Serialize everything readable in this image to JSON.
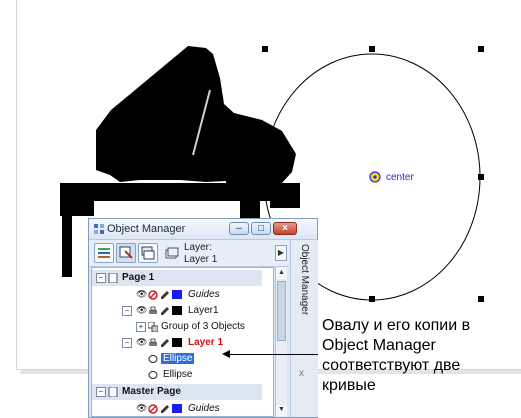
{
  "canvas": {
    "ellipse_label": "center"
  },
  "object_manager": {
    "title": "Object Manager",
    "side_tab_label": "Object Manager",
    "side_tab_close": "x",
    "toolbar": {
      "layer_caption": "Layer:",
      "layer_name": "Layer 1"
    },
    "tree": [
      {
        "label": "Page 1",
        "level": "page"
      },
      {
        "label": "Guides",
        "level": "layer"
      },
      {
        "label": "Layer1",
        "level": "layer"
      },
      {
        "label": "Group of 3 Objects",
        "level": "object"
      },
      {
        "label": "Layer 1",
        "level": "layer"
      },
      {
        "label": "Ellipse",
        "level": "object",
        "selected": true
      },
      {
        "label": "Ellipse",
        "level": "object"
      },
      {
        "label": "Master Page",
        "level": "page"
      },
      {
        "label": "Guides",
        "level": "layer"
      }
    ]
  },
  "annotation": {
    "lines": [
      "Овалу и его копии в",
      "Object Manager",
      "соответствуют две",
      "кривые"
    ]
  },
  "colors": {
    "selection": "#2f6fd2",
    "active_layer": "#d01010",
    "guides_swatch": "#1a1aff",
    "layer_swatch": "#000000"
  }
}
